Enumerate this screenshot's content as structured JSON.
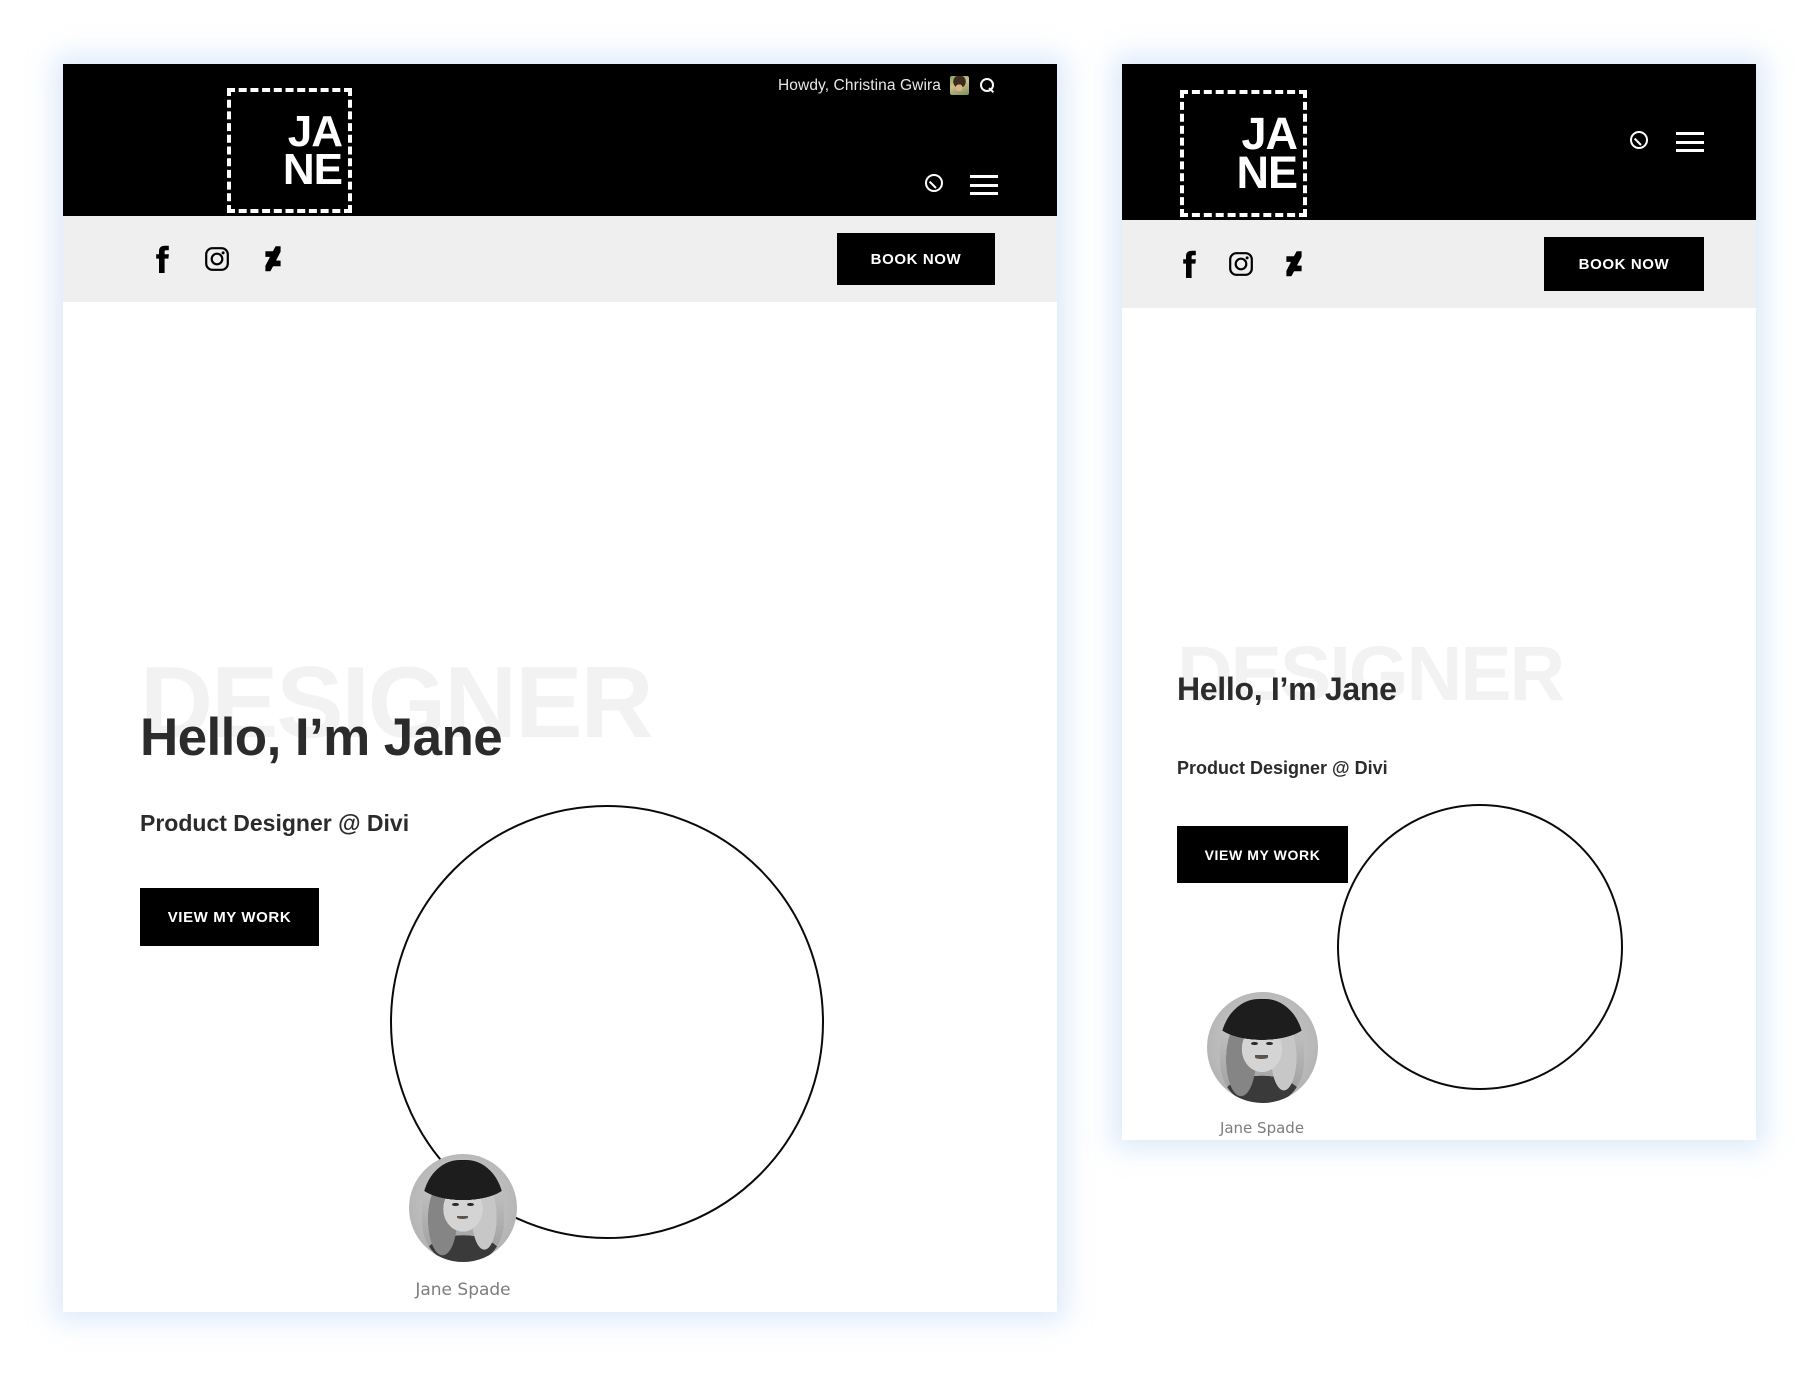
{
  "page": {
    "background_color": "#ffffff",
    "glow_color": "#96bef0"
  },
  "panels": [
    {
      "id": "desktop-preview",
      "variant": "desktop",
      "admin_bar": {
        "greeting": "Howdy, Christina Gwira",
        "avatar_icon": "user-avatar-thumbnail",
        "search_icon": "search-icon"
      },
      "header": {
        "logo": {
          "line1": "JA",
          "line2": "NE",
          "style": "dashed-square"
        },
        "search_icon": "search-icon",
        "menu_icon": "hamburger-menu-icon",
        "background_color": "#000000"
      },
      "sub_bar": {
        "background_color": "#efefef",
        "social": [
          {
            "name": "facebook-icon",
            "label": "Facebook"
          },
          {
            "name": "instagram-icon",
            "label": "Instagram"
          },
          {
            "name": "deviantart-icon",
            "label": "DeviantArt"
          }
        ],
        "cta_label": "BOOK NOW"
      },
      "hero": {
        "watermark": "DESIGNER",
        "watermark_color": "#f2f2f2",
        "title": "Hello, I’m Jane",
        "subtitle": "Product Designer @ Divi",
        "button_label": "VIEW MY WORK",
        "ring_icon": "outline-circle-shape",
        "profile": {
          "photo_icon": "profile-photo-grayscale",
          "name": "Jane Spade"
        }
      }
    },
    {
      "id": "mobile-preview",
      "variant": "mobile",
      "header": {
        "logo": {
          "line1": "JA",
          "line2": "NE",
          "style": "dashed-square"
        },
        "search_icon": "search-icon",
        "menu_icon": "hamburger-menu-icon",
        "background_color": "#000000"
      },
      "sub_bar": {
        "background_color": "#efefef",
        "social": [
          {
            "name": "facebook-icon",
            "label": "Facebook"
          },
          {
            "name": "instagram-icon",
            "label": "Instagram"
          },
          {
            "name": "deviantart-icon",
            "label": "DeviantArt"
          }
        ],
        "cta_label": "BOOK NOW"
      },
      "hero": {
        "watermark": "DESIGNER",
        "watermark_color": "#f2f2f2",
        "title": "Hello, I’m Jane",
        "subtitle": "Product Designer @ Divi",
        "button_label": "VIEW MY WORK",
        "ring_icon": "outline-circle-shape",
        "profile": {
          "photo_icon": "profile-photo-grayscale",
          "name": "Jane Spade"
        }
      }
    }
  ]
}
